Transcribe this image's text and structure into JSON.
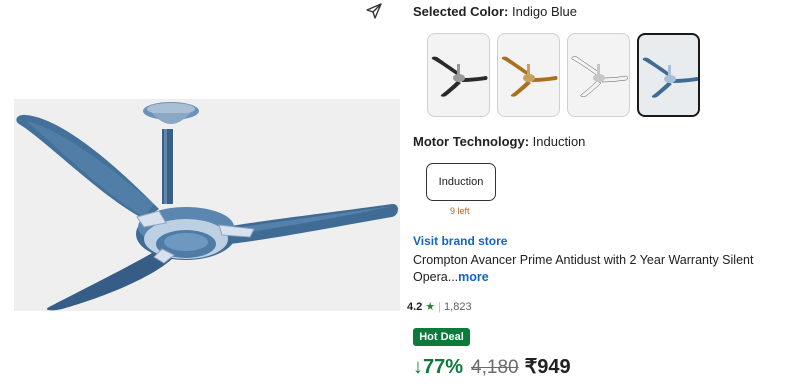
{
  "product_image": {
    "share_icon": "share-arrow-icon"
  },
  "color_section": {
    "label_key": "Selected Color:",
    "label_value": " Indigo Blue",
    "swatches": [
      {
        "name": "Black",
        "blade_color": "#2a2a2a",
        "hub_color": "#9a9a9a"
      },
      {
        "name": "Golden Brown",
        "blade_color": "#a8701f",
        "hub_color": "#c9a060"
      },
      {
        "name": "White",
        "blade_color": "#f2f2f2",
        "hub_color": "#c7c7c7"
      },
      {
        "name": "Indigo Blue",
        "blade_color": "#3f6b94",
        "hub_color": "#a9bfd6"
      }
    ],
    "selected_index": 3
  },
  "motor_section": {
    "label_key": "Motor Technology:",
    "label_value": " Induction",
    "option_label": "Induction",
    "stock_note": "9 left"
  },
  "product": {
    "brand_link": "Visit brand store",
    "title": "Crompton Avancer Prime Antidust with 2 Year Warranty Silent Opera...",
    "more_link": "more",
    "rating": "4.2",
    "rating_count": "1,823",
    "deal_badge": "Hot Deal",
    "discount": "↓77%",
    "mrp": "4,180",
    "price": "₹949"
  },
  "colors": {
    "accent_blue": "#1565c0",
    "deal_green": "#0b7a3b",
    "fan_blue": "#3f6b94"
  }
}
